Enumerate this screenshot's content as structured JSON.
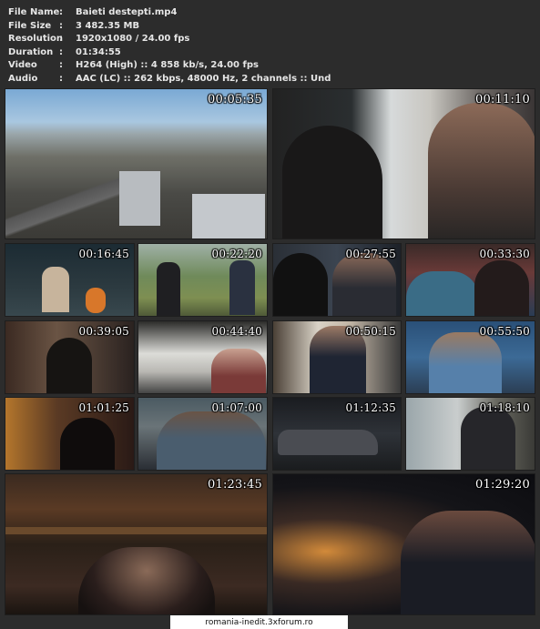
{
  "info": [
    {
      "key": "File Name",
      "value": "Baieti destepti.mp4"
    },
    {
      "key": "File Size",
      "value": "3 482.35 MB"
    },
    {
      "key": "Resolution",
      "value": "1920x1080 / 24.00 fps"
    },
    {
      "key": "Duration",
      "value": "01:34:55"
    },
    {
      "key": "Video",
      "value": "H264 (High) :: 4 858 kb/s, 24.00 fps"
    },
    {
      "key": "Audio",
      "value": "AAC (LC) :: 262 kbps, 48000 Hz, 2 channels :: Und"
    }
  ],
  "separator": ":",
  "thumbnails": [
    "00:05:35",
    "00:11:10",
    "00:16:45",
    "00:22:20",
    "00:27:55",
    "00:33:30",
    "00:39:05",
    "00:44:40",
    "00:50:15",
    "00:55:50",
    "01:01:25",
    "01:07:00",
    "01:12:35",
    "01:18:10",
    "01:23:45",
    "01:29:20"
  ],
  "footer": "romania-inedit.3xforum.ro"
}
